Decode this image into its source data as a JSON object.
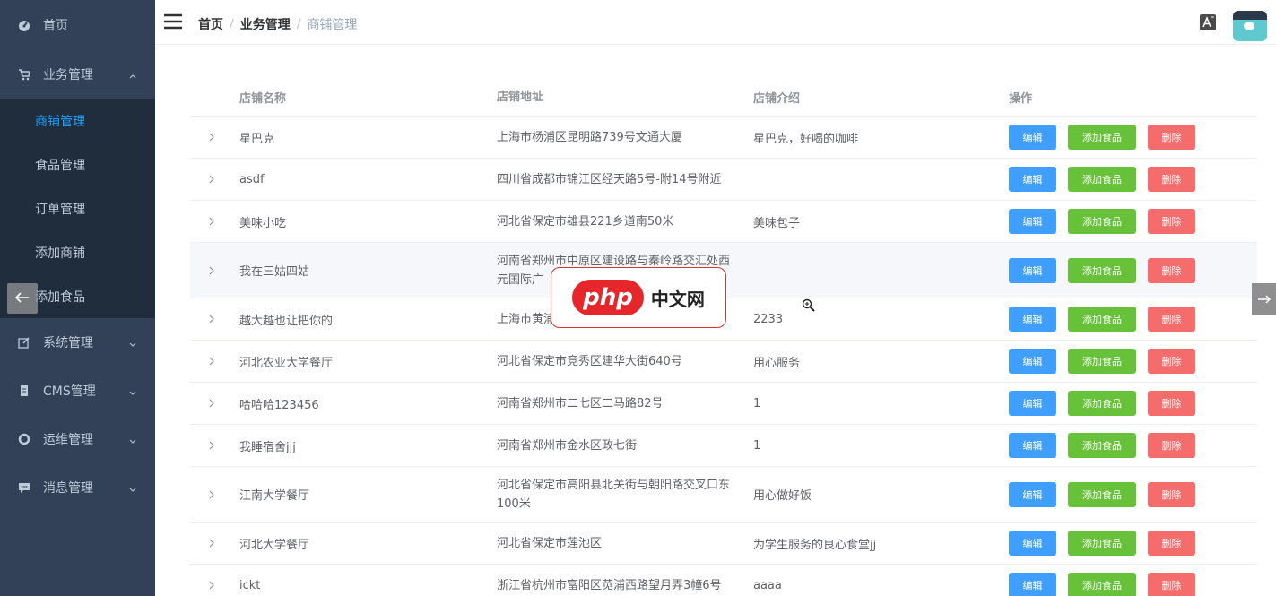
{
  "sidebar": {
    "items": [
      {
        "label": "首页",
        "icon": "dashboard-icon"
      },
      {
        "label": "业务管理",
        "icon": "cart-icon"
      },
      {
        "label": "系统管理",
        "icon": "edit-icon"
      },
      {
        "label": "CMS管理",
        "icon": "document-icon"
      },
      {
        "label": "运维管理",
        "icon": "circle-icon"
      },
      {
        "label": "消息管理",
        "icon": "message-icon"
      }
    ],
    "sub": [
      "商铺管理",
      "食品管理",
      "订单管理",
      "添加商铺",
      "添加食品"
    ]
  },
  "header": {
    "breadcrumb": [
      "首页",
      "业务管理",
      "商铺管理"
    ],
    "sep": "/"
  },
  "table": {
    "headers": [
      "店铺名称",
      "店铺地址",
      "店铺介绍",
      "操作"
    ],
    "ops": {
      "edit": "编辑",
      "add": "添加食品",
      "del": "删除"
    },
    "rows": [
      {
        "name": "星巴克",
        "addr": "上海市杨浦区昆明路739号文通大厦",
        "intro": "星巴克，好喝的咖啡"
      },
      {
        "name": "asdf",
        "addr": "四川省成都市锦江区经天路5号-附14号附近",
        "intro": ""
      },
      {
        "name": "美味小吃",
        "addr": "河北省保定市雄县221乡道南50米",
        "intro": "美味包子"
      },
      {
        "name": "我在三姑四姑",
        "addr": "河南省郑州市中原区建设路与秦岭路交汇处西元国际广",
        "intro": ""
      },
      {
        "name": "越大越也让把你的",
        "addr": "上海市黄浦",
        "intro": "2233"
      },
      {
        "name": "河北农业大学餐厅",
        "addr": "河北省保定市竞秀区建华大街640号",
        "intro": "用心服务"
      },
      {
        "name": "哈哈哈123456",
        "addr": "河南省郑州市二七区二马路82号",
        "intro": "1"
      },
      {
        "name": "我睡宿舍jjj",
        "addr": "河南省郑州市金水区政七街",
        "intro": "1"
      },
      {
        "name": "江南大学餐厅",
        "addr": "河北省保定市高阳县北关街与朝阳路交叉口东100米",
        "intro": "用心做好饭"
      },
      {
        "name": "河北大学餐厅",
        "addr": "河北省保定市莲池区",
        "intro": "为学生服务的良心食堂jj"
      },
      {
        "name": "ickt",
        "addr": "浙江省杭州市富阳区苋浦西路望月弄3幢6号",
        "intro": "aaaa"
      }
    ]
  },
  "overlay": {
    "logo_text": "php",
    "logo_cn": "中文网"
  }
}
